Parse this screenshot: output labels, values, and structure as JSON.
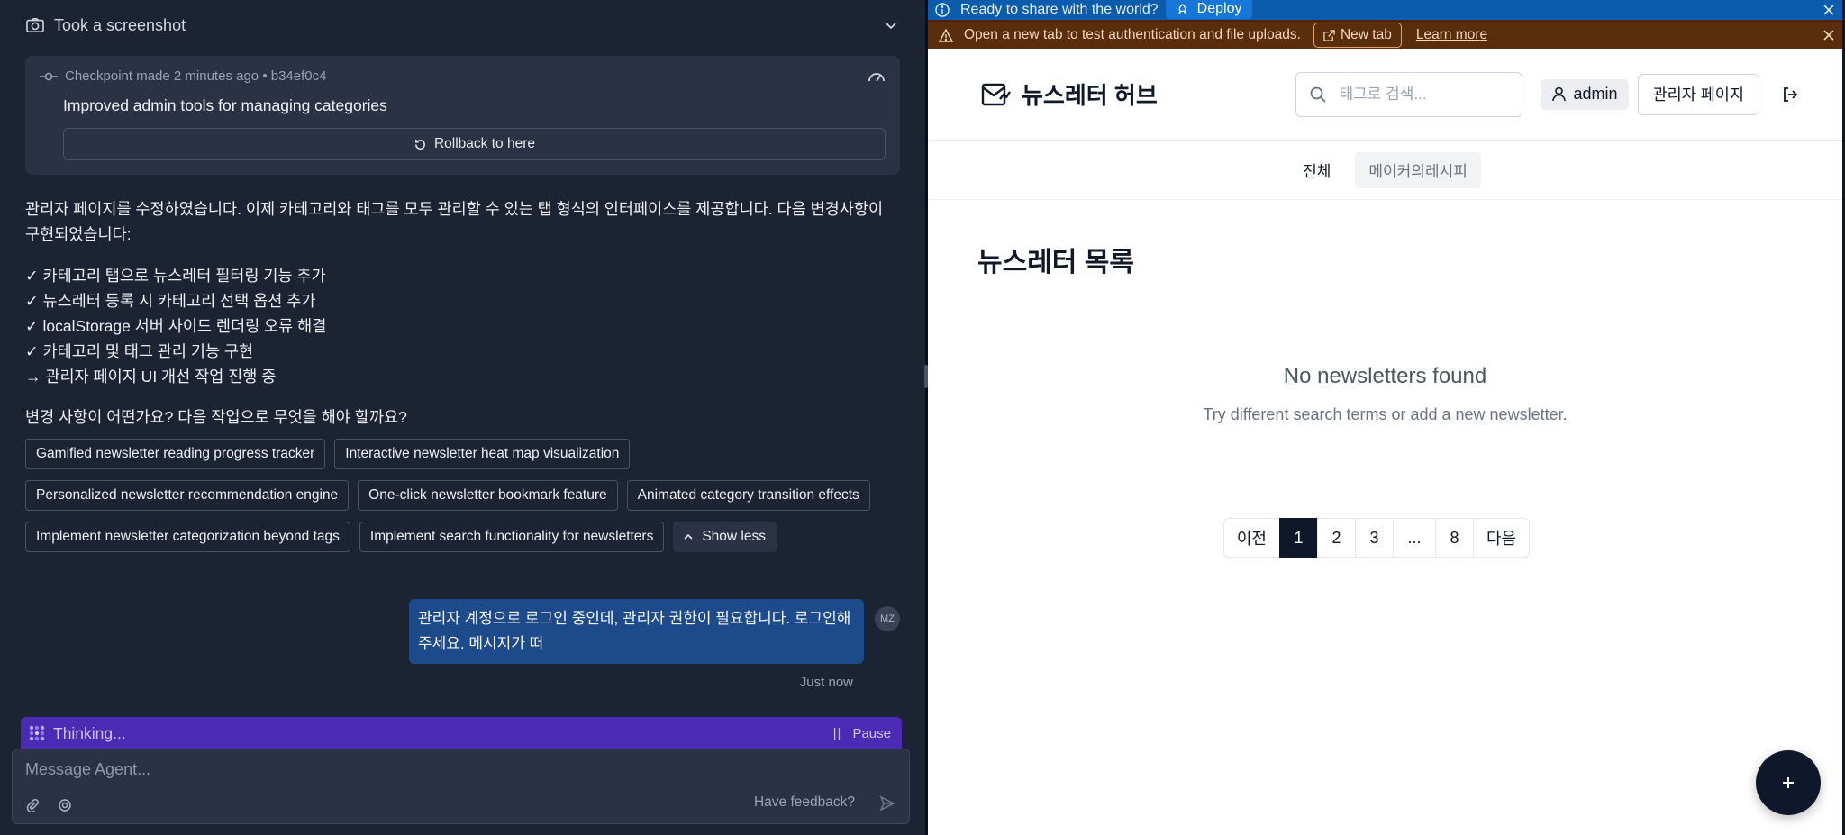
{
  "agent": {
    "screenshot_label": "Took a screenshot",
    "checkpoint": {
      "made_label": "Checkpoint made",
      "time": "2 minutes ago",
      "separator": "•",
      "hash": "b34ef0c4",
      "title": "Improved admin tools for managing categories",
      "rollback_label": "Rollback to here"
    },
    "message": "관리자 페이지를 수정하였습니다. 이제 카테고리와 태그를 모두 관리할 수 있는 탭 형식의 인터페이스를 제공합니다. 다음 변경사항이 구현되었습니다:",
    "checklist": [
      "✓ 카테고리 탭으로 뉴스레터 필터링 기능 추가",
      "✓ 뉴스레터 등록 시 카테고리 선택 옵션 추가",
      "✓ localStorage 서버 사이드 렌더링 오류 해결",
      "✓ 카테고리 및 태그 관리 기능 구현",
      "→ 관리자 페이지 UI 개선 작업 진행 중"
    ],
    "question": "변경 사항이 어떤가요? 다음 작업으로 무엇을 해야 할까요?",
    "suggestions": [
      "Gamified newsletter reading progress tracker",
      "Interactive newsletter heat map visualization",
      "Personalized newsletter recommendation engine",
      "One-click newsletter bookmark feature",
      "Animated category transition effects",
      "Implement newsletter categorization beyond tags",
      "Implement search functionality for newsletters"
    ],
    "show_less_label": "Show less",
    "user_message": "관리자 계정으로 로그인 중인데, 관리자 권한이 필요합니다. 로그인해주세요. 메시지가 떠",
    "user_initials": "MZ",
    "user_time": "Just now",
    "thinking_label": "Thinking...",
    "pause_label": "Pause",
    "composer_placeholder": "Message Agent...",
    "feedback_label": "Have feedback?"
  },
  "preview": {
    "deploy_bar": {
      "text": "Ready to share with the world?",
      "button": "Deploy"
    },
    "warn_bar": {
      "text": "Open a new tab to test authentication and file uploads.",
      "newtab_button": "New tab",
      "learn_more": "Learn more"
    },
    "site": {
      "logo_text": "뉴스레터 허브",
      "search_placeholder": "태그로 검색...",
      "user_label": "admin",
      "admin_page_label": "관리자 페이지",
      "tabs": [
        "전체",
        "메이커의레시피"
      ],
      "page_title": "뉴스레터 목록",
      "empty_title": "No newsletters found",
      "empty_subtitle": "Try different search terms or add a new newsletter.",
      "pagination": {
        "prev": "이전",
        "pages": [
          "1",
          "2",
          "3"
        ],
        "ellipsis": "...",
        "last_page": "8",
        "next": "다음",
        "current": 1
      }
    }
  },
  "colors": {
    "agent_bg": "#1c2333",
    "card_bg": "#2b3245",
    "user_bubble": "#1d4a8a",
    "thinking_bar": "#4a2bb4",
    "deploy_bar": "#0b5cad",
    "warn_bar": "#5a2d0c",
    "primary_dark": "#0f172a"
  },
  "icons": {
    "screenshot": "camera-icon",
    "checkpoint": "git-commit-icon",
    "gauge": "gauge-icon",
    "rollback": "rotate-ccw-icon",
    "info": "info-icon",
    "deploy": "rocket-icon",
    "warning": "alert-triangle-icon",
    "external": "external-link-icon",
    "logo": "mail-chart-icon",
    "search": "search-icon",
    "user": "user-icon",
    "logout": "log-out-icon",
    "add": "plus-icon"
  }
}
